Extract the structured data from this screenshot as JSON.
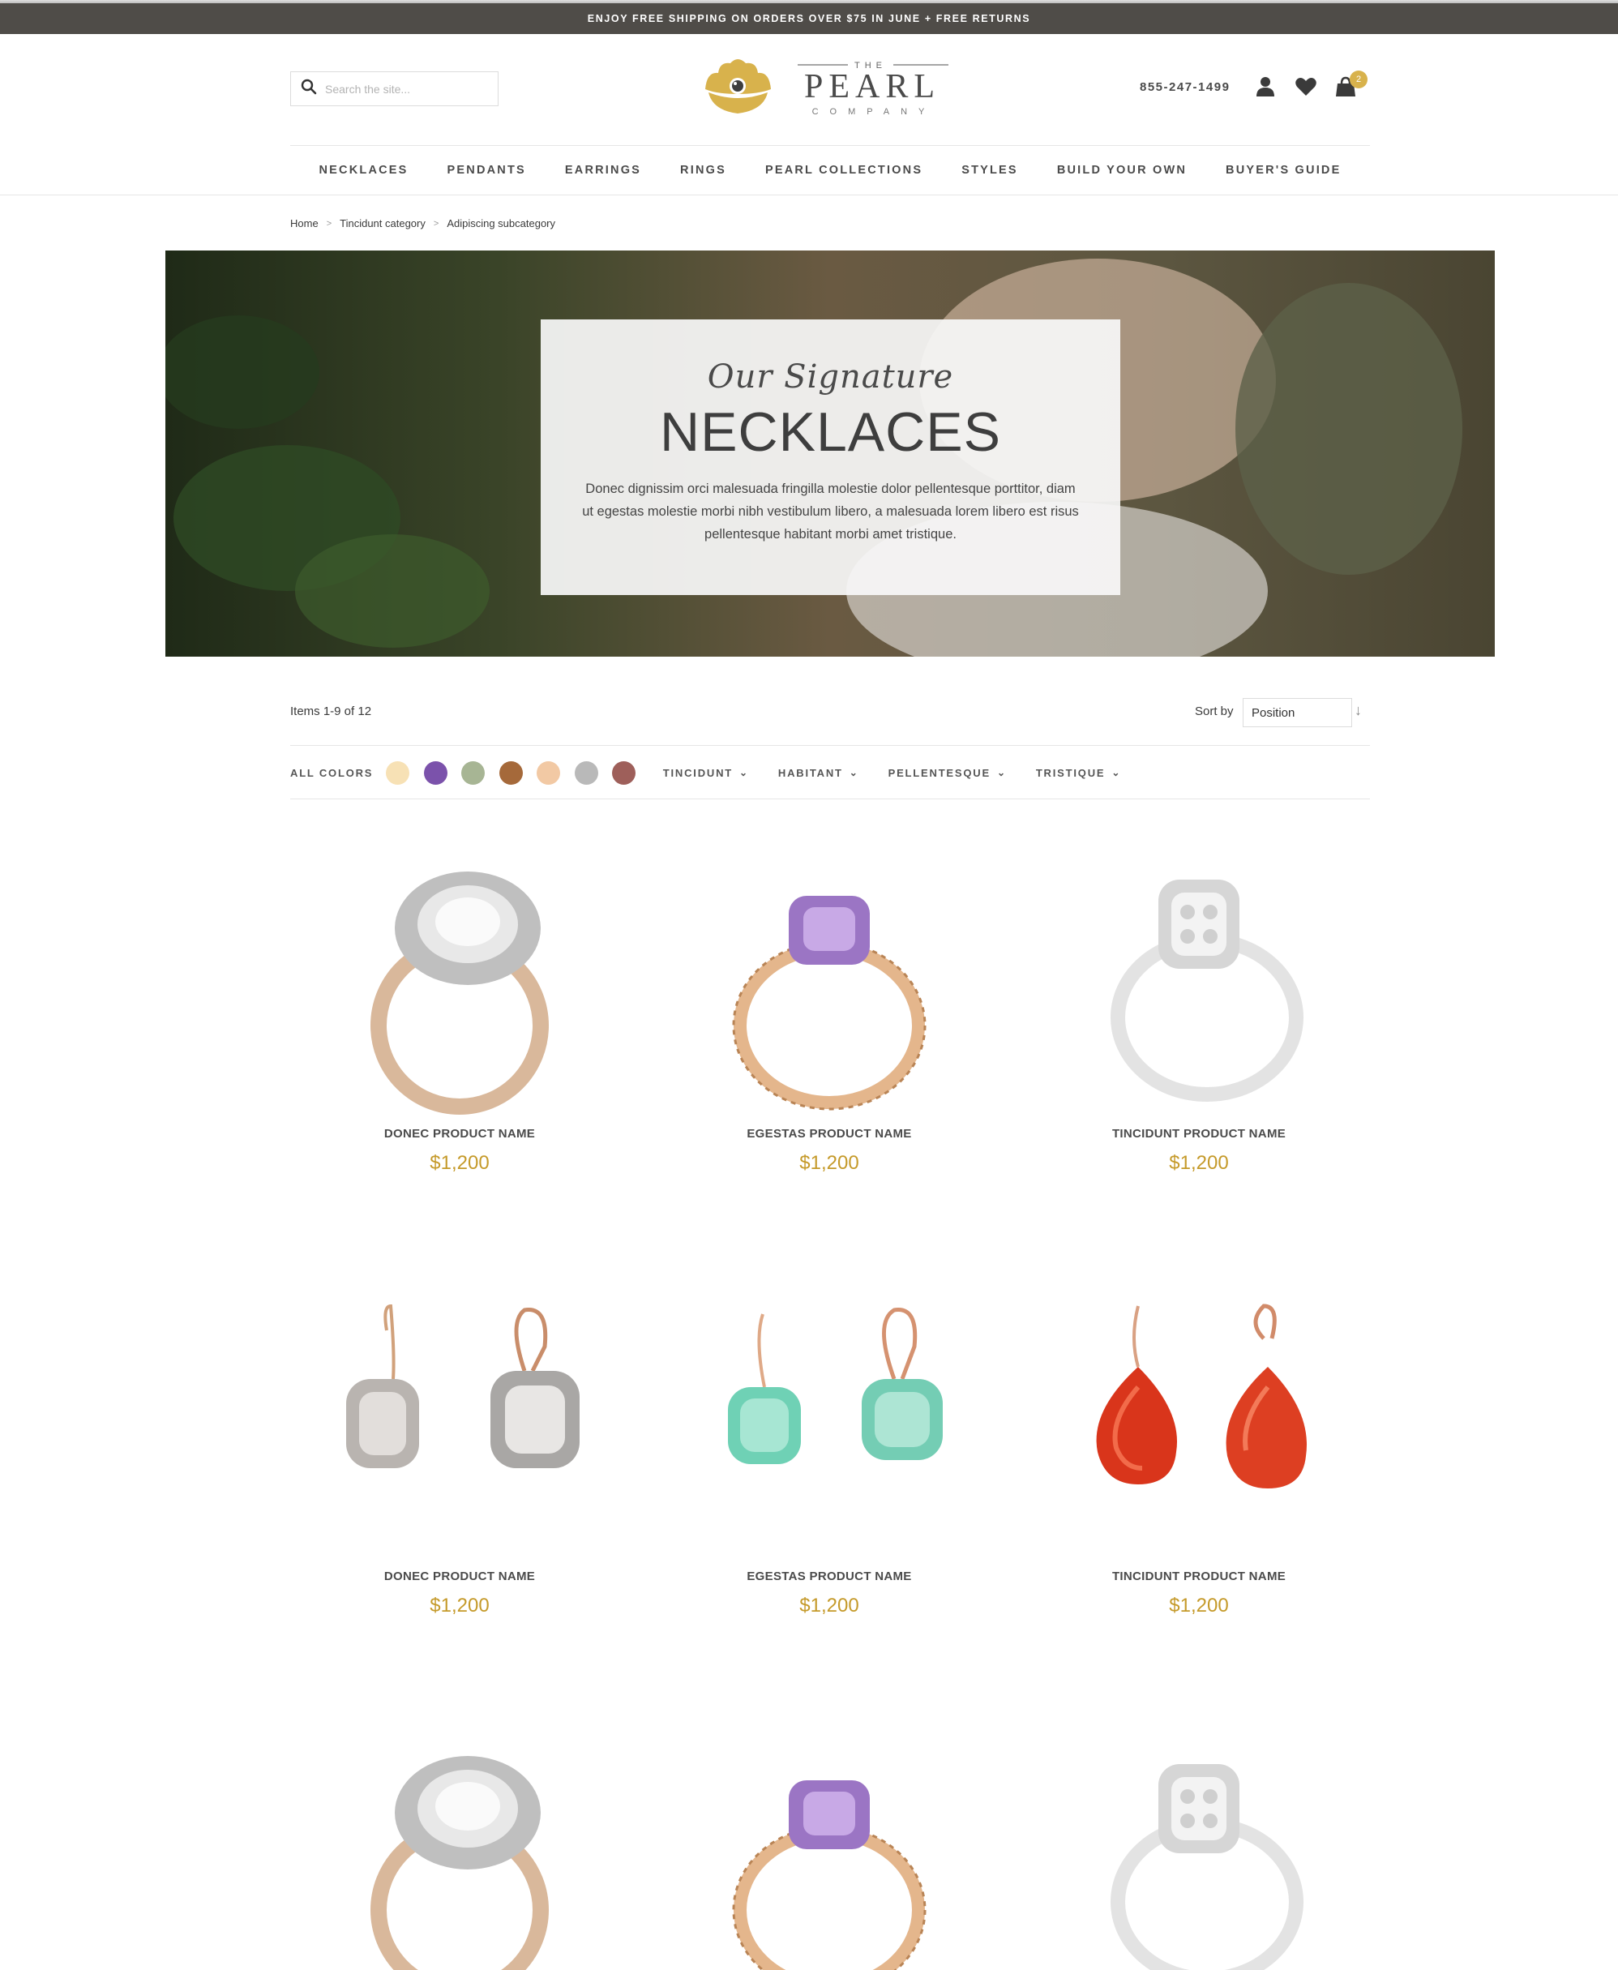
{
  "promo": {
    "text": "ENJOY FREE SHIPPING ON ORDERS OVER $75 IN JUNE + FREE RETURNS"
  },
  "header": {
    "search_placeholder": "Search the site...",
    "logo": {
      "the": "THE",
      "name": "PEARL",
      "company": "COMPANY"
    },
    "phone": "855-247-1499",
    "cart_count": "2",
    "icons": [
      "search-icon",
      "account-icon",
      "heart-icon",
      "bag-icon"
    ]
  },
  "nav": {
    "items": [
      {
        "label": "NECKLACES"
      },
      {
        "label": "PENDANTS"
      },
      {
        "label": "EARRINGS"
      },
      {
        "label": "RINGS"
      },
      {
        "label": "PEARL COLLECTIONS"
      },
      {
        "label": "STYLES"
      },
      {
        "label": "BUILD YOUR OWN"
      },
      {
        "label": "BUYER'S GUIDE"
      }
    ]
  },
  "breadcrumb": {
    "home": "Home",
    "category": "Tincidunt category",
    "subcategory": "Adipiscing subcategory",
    "separator": ">"
  },
  "hero": {
    "script": "Our Signature",
    "title": "NECKLACES",
    "text": "Donec dignissim orci malesuada fringilla molestie dolor pellentesque porttitor, diam ut egestas molestie morbi nibh vestibulum libero, a malesuada lorem libero est risus pellentesque habitant morbi amet tristique."
  },
  "toolbar": {
    "items_count": "Items 1-9 of 12",
    "sort_label": "Sort by",
    "sort_value": "Position",
    "sort_arrow": "↓"
  },
  "filters": {
    "all_colors": "ALL COLORS",
    "swatches": [
      "#f7e1b5",
      "#7b52ab",
      "#a7b594",
      "#a5693a",
      "#f2c9a4",
      "#b9b9b9",
      "#9e5f5a"
    ],
    "dropdowns": [
      "TINCIDUNT",
      "HABITANT",
      "PELLENTESQUE",
      "TRISTIQUE"
    ],
    "chevron": "⌄"
  },
  "products": [
    {
      "name": "DONEC PRODUCT NAME",
      "price": "$1,200"
    },
    {
      "name": "EGESTAS PRODUCT NAME",
      "price": "$1,200"
    },
    {
      "name": "TINCIDUNT PRODUCT NAME",
      "price": "$1,200"
    },
    {
      "name": "DONEC PRODUCT NAME",
      "price": "$1,200"
    },
    {
      "name": "EGESTAS PRODUCT NAME",
      "price": "$1,200"
    },
    {
      "name": "TINCIDUNT PRODUCT NAME",
      "price": "$1,200"
    }
  ],
  "colors": {
    "promo_bg": "#4f4c48",
    "accent_gold": "#c59a2a",
    "logo_gold": "#d8b24c"
  }
}
